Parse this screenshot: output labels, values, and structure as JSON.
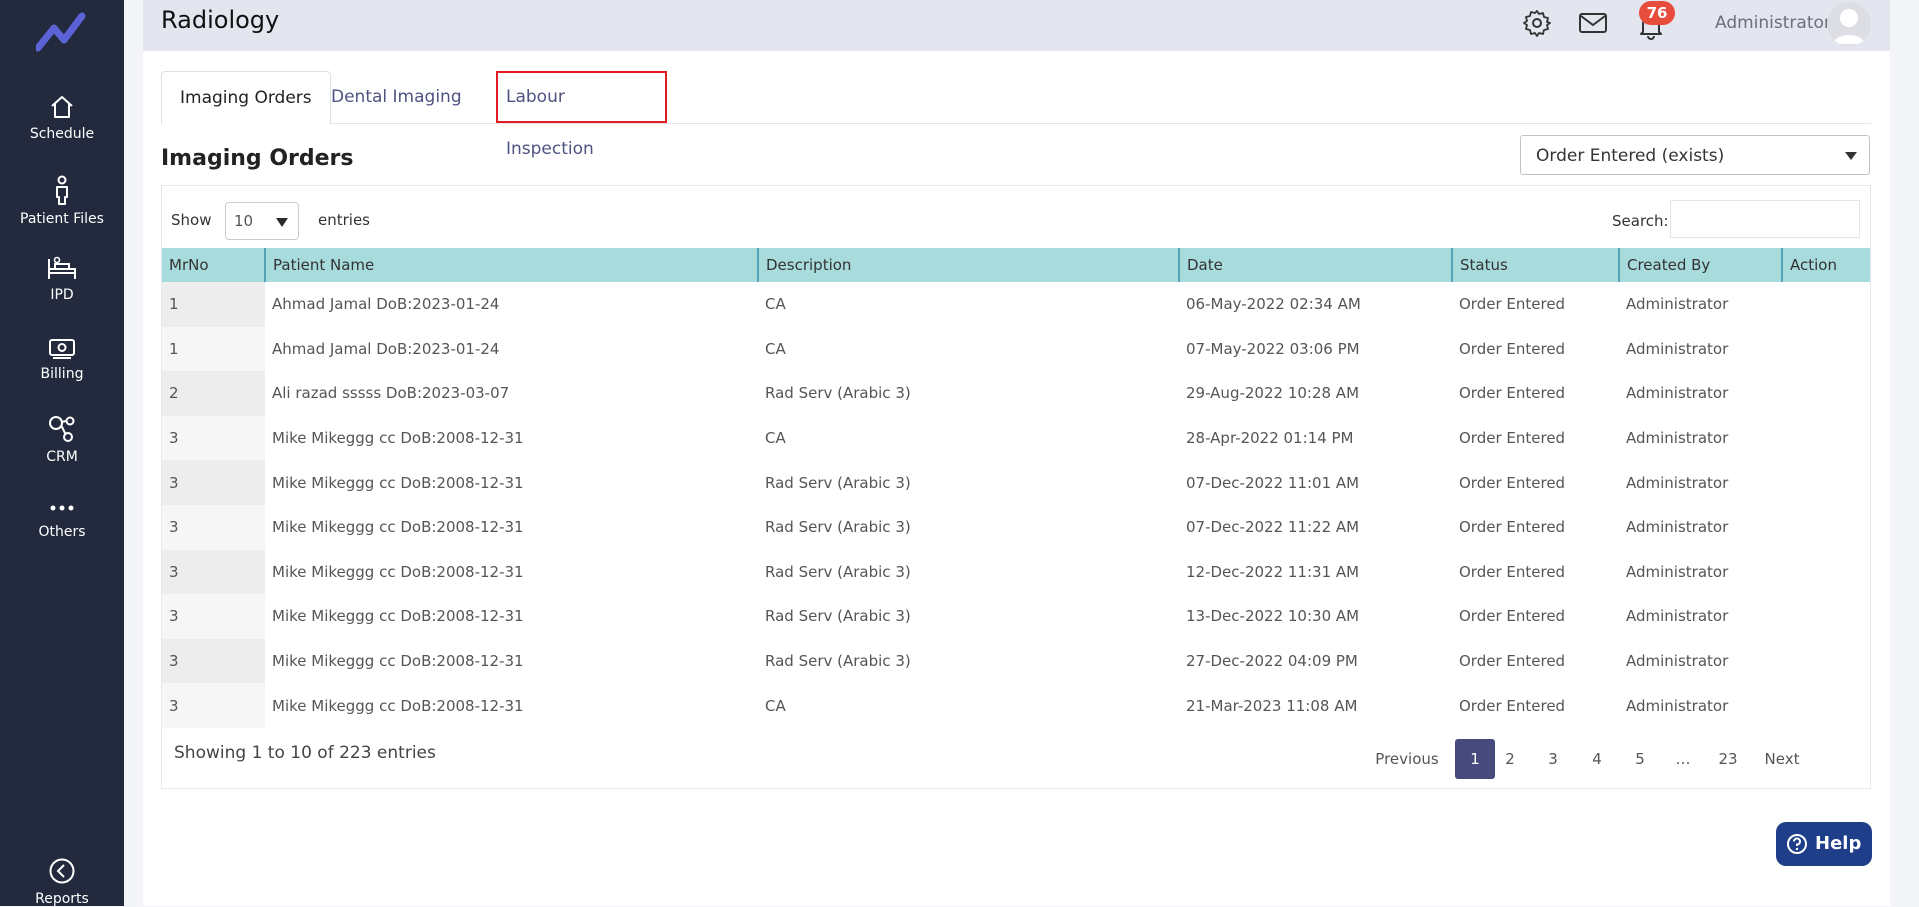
{
  "sidebar": {
    "items": [
      {
        "label": "Schedule",
        "icon": "home-icon"
      },
      {
        "label": "Patient Files",
        "icon": "person-icon"
      },
      {
        "label": "IPD",
        "icon": "bed-icon"
      },
      {
        "label": "Billing",
        "icon": "money-icon"
      },
      {
        "label": "CRM",
        "icon": "network-icon"
      },
      {
        "label": "Others",
        "icon": "more-icon"
      },
      {
        "label": "Reports",
        "icon": "back-circle-icon"
      }
    ]
  },
  "header": {
    "title": "Radiology",
    "notification_count": "76",
    "user_name": "Administrator"
  },
  "tabs": [
    {
      "label": "Imaging Orders",
      "active": true
    },
    {
      "label": "Dental Imaging",
      "active": false
    },
    {
      "label": "Labour Inspection",
      "active": false
    }
  ],
  "section": {
    "title": "Imaging Orders",
    "filter_value": "Order Entered (exists)"
  },
  "table_controls": {
    "show_label": "Show",
    "entries_value": "10",
    "entries_label": "entries",
    "search_label": "Search:",
    "search_value": ""
  },
  "table": {
    "columns": [
      "MrNo",
      "Patient Name",
      "Description",
      "Date",
      "Status",
      "Created By",
      "Action"
    ],
    "rows": [
      [
        "1",
        "Ahmad Jamal DoB:2023-01-24",
        "CA",
        "06-May-2022 02:34 AM",
        "Order Entered",
        "Administrator",
        ""
      ],
      [
        "1",
        "Ahmad Jamal DoB:2023-01-24",
        "CA",
        "07-May-2022 03:06 PM",
        "Order Entered",
        "Administrator",
        ""
      ],
      [
        "2",
        "Ali razad sssss DoB:2023-03-07",
        "Rad Serv (Arabic 3)",
        "29-Aug-2022 10:28 AM",
        "Order Entered",
        "Administrator",
        ""
      ],
      [
        "3",
        "Mike Mikeggg cc DoB:2008-12-31",
        "CA",
        "28-Apr-2022 01:14 PM",
        "Order Entered",
        "Administrator",
        ""
      ],
      [
        "3",
        "Mike Mikeggg cc DoB:2008-12-31",
        "Rad Serv (Arabic 3)",
        "07-Dec-2022 11:01 AM",
        "Order Entered",
        "Administrator",
        ""
      ],
      [
        "3",
        "Mike Mikeggg cc DoB:2008-12-31",
        "Rad Serv (Arabic 3)",
        "07-Dec-2022 11:22 AM",
        "Order Entered",
        "Administrator",
        ""
      ],
      [
        "3",
        "Mike Mikeggg cc DoB:2008-12-31",
        "Rad Serv (Arabic 3)",
        "12-Dec-2022 11:31 AM",
        "Order Entered",
        "Administrator",
        ""
      ],
      [
        "3",
        "Mike Mikeggg cc DoB:2008-12-31",
        "Rad Serv (Arabic 3)",
        "13-Dec-2022 10:30 AM",
        "Order Entered",
        "Administrator",
        ""
      ],
      [
        "3",
        "Mike Mikeggg cc DoB:2008-12-31",
        "Rad Serv (Arabic 3)",
        "27-Dec-2022 04:09 PM",
        "Order Entered",
        "Administrator",
        ""
      ],
      [
        "3",
        "Mike Mikeggg cc DoB:2008-12-31",
        "CA",
        "21-Mar-2023 11:08 AM",
        "Order Entered",
        "Administrator",
        ""
      ]
    ]
  },
  "footer": {
    "showing_text": "Showing 1 to 10 of 223 entries",
    "pagination": {
      "previous": "Previous",
      "pages": [
        "1",
        "2",
        "3",
        "4",
        "5",
        "…",
        "23"
      ],
      "current": "1",
      "next": "Next"
    }
  },
  "help_button": {
    "label": "Help"
  },
  "colors": {
    "sidebar": "#232a3d",
    "accent": "#474a7c",
    "table_header": "#a8dbdc",
    "badge": "#e74c3c",
    "highlight_outline": "#e01d24",
    "help": "#1e3e8a"
  }
}
